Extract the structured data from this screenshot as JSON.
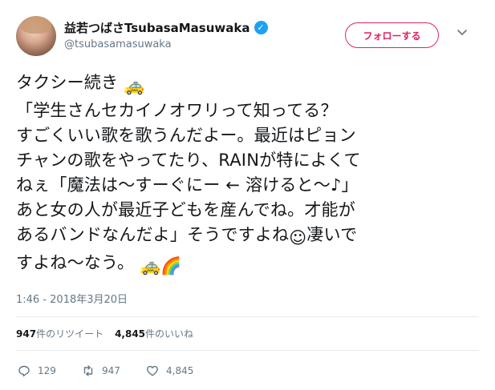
{
  "user": {
    "display_name": "益若つばさTsubasaMasuwaka",
    "handle": "@tsubasamasuwaka",
    "verified_glyph": "✓"
  },
  "follow_button": {
    "label": "フォローする",
    "color": "#e0245e"
  },
  "tweet": {
    "lines": [
      "タクシー続き",
      "「学生さんセカイノオワリって知ってる？",
      "すごくいい歌を歌うんだよー。最近はピョン",
      "チャンの歌をやってたり、RAINが特によくて",
      "ねぇ「魔法は〜すーぐにー ← 溶けると〜♪」",
      "あと女の人が最近子どもを産んでね。才能が",
      "あるバンドなんだよ」そうですよね",
      "凄いで",
      "すよね〜なう。"
    ],
    "emojis": {
      "taxi": "🚕",
      "blush": "☺",
      "rainbow": "🌈"
    },
    "timestamp": "1:46 - 2018年3月20日"
  },
  "stats": {
    "retweets_count": "947",
    "retweets_label": "件のリツイート",
    "likes_count": "4,845",
    "likes_label": "件のいいね"
  },
  "actions": {
    "reply_count": "129",
    "retweet_count": "947",
    "like_count": "4,845"
  }
}
